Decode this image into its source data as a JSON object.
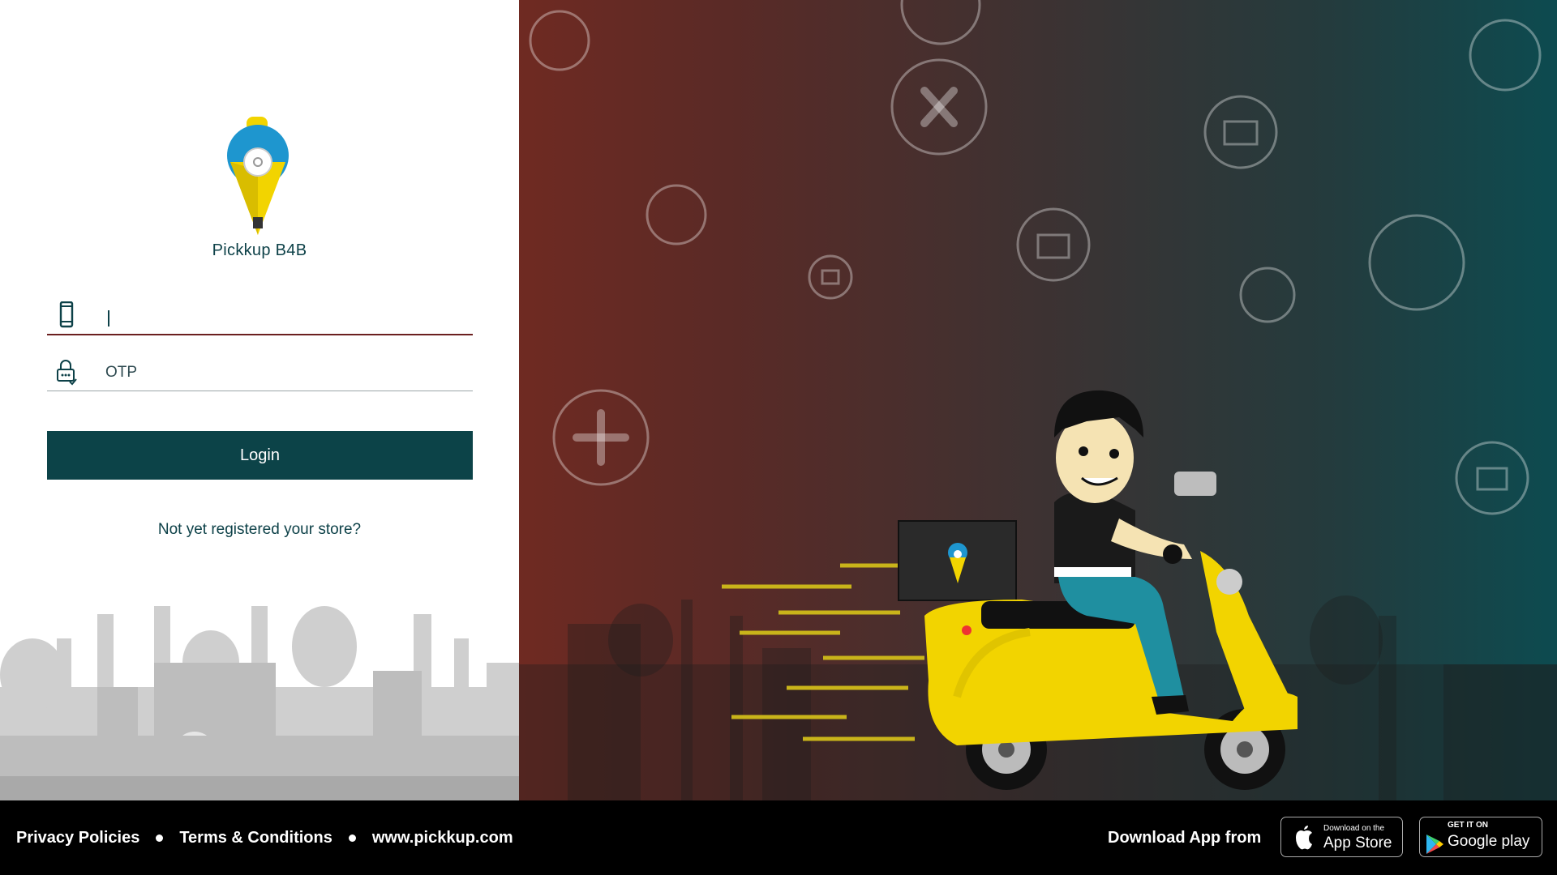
{
  "brand": {
    "name": "Pickkup B4B"
  },
  "login_form": {
    "phone_value": "",
    "otp_placeholder": "OTP",
    "login_label": "Login",
    "register_link": "Not yet registered your store?"
  },
  "footer": {
    "links": [
      "Privacy Policies",
      "Terms & Conditions",
      "www.pickkup.com"
    ],
    "download_text": "Download App from",
    "app_store": {
      "small": "Download on the",
      "big": "App Store"
    },
    "google_play": {
      "small": "GET IT ON",
      "big": "Google play"
    }
  },
  "colors": {
    "primary": "#0c4348",
    "accent_yellow": "#f2d400",
    "logo_blue": "#1e96cf",
    "gradient_left": "#6f2a22",
    "gradient_right": "#0d4b50"
  },
  "icons": [
    "mobile-phone-icon",
    "otp-lock-icon",
    "apple-icon",
    "google-play-icon"
  ]
}
